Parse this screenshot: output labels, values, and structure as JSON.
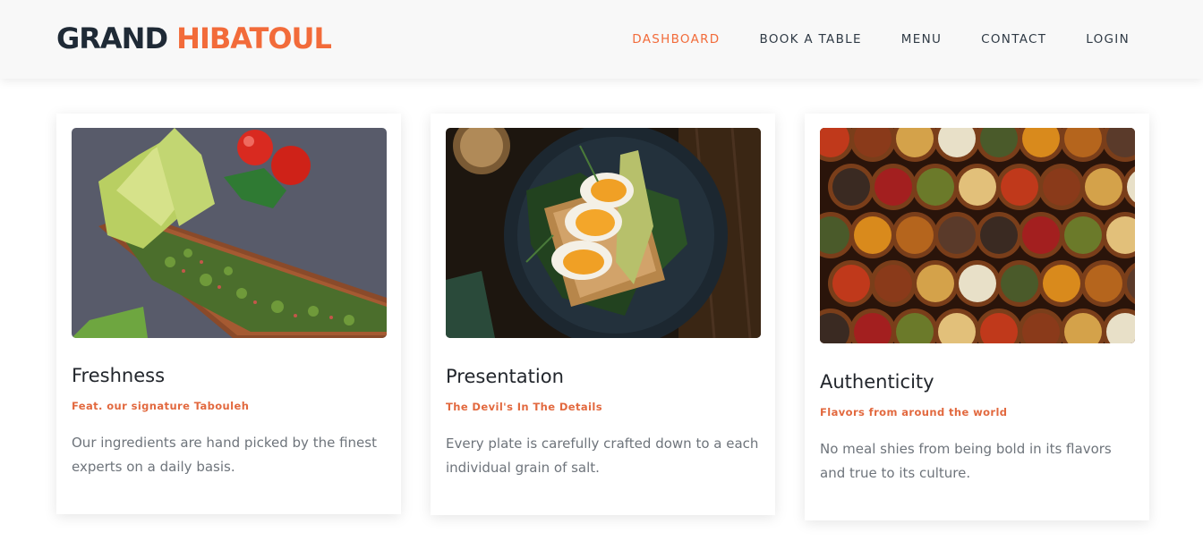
{
  "header": {
    "brand_part1": "GRAND",
    "brand_part2": "HIBATOUL",
    "nav": {
      "dashboard": "DASHBOARD",
      "book": "BOOK A TABLE",
      "menu": "MENU",
      "contact": "CONTACT",
      "login": "LOGIN"
    }
  },
  "cards": [
    {
      "title": "Freshness",
      "subtitle": "Feat. our signature Tabouleh",
      "text": "Our ingredients are hand picked by the finest experts on a daily basis."
    },
    {
      "title": "Presentation",
      "subtitle": "The Devil's In The Details",
      "text": "Every plate is carefully crafted down to a each individual grain of salt."
    },
    {
      "title": "Authenticity",
      "subtitle": "Flavors from around the world",
      "text": "No meal shies from being bold in its flavors and true to its culture."
    }
  ],
  "colors": {
    "accent": "#f26b3a",
    "brand_dark": "#1f2a36",
    "nav_bg": "#f8f8f8"
  }
}
